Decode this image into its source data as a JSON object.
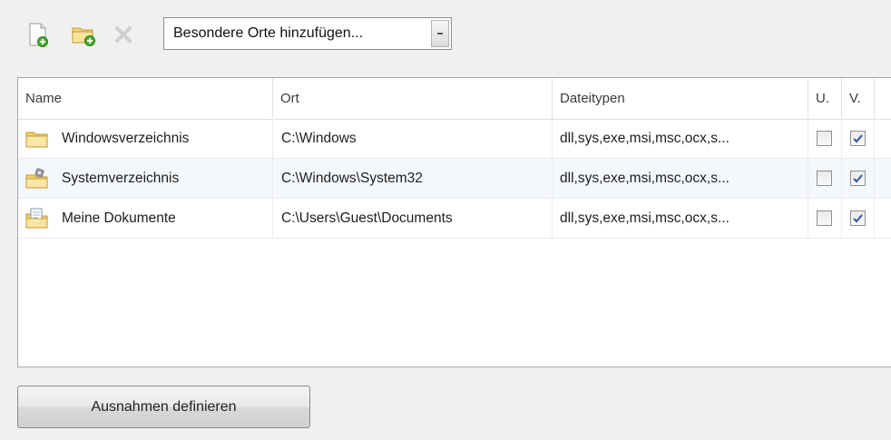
{
  "toolbar": {
    "new_icon": "new-document-icon",
    "folder_icon": "add-folder-icon",
    "delete_icon": "delete-icon",
    "combo_value": "Besondere Orte hinzufügen..."
  },
  "table": {
    "columns": [
      "Name",
      "Ort",
      "Dateitypen",
      "U.",
      "V."
    ],
    "rows": [
      {
        "icon": "folder-icon",
        "name": "Windowsverzeichnis",
        "ort": "C:\\Windows",
        "types": "dll,sys,exe,msi,msc,ocx,s...",
        "u": false,
        "v": true
      },
      {
        "icon": "system-folder-icon",
        "name": "Systemverzeichnis",
        "ort": "C:\\Windows\\System32",
        "types": "dll,sys,exe,msi,msc,ocx,s...",
        "u": false,
        "v": true
      },
      {
        "icon": "documents-folder-icon",
        "name": "Meine Dokumente",
        "ort": "C:\\Users\\Guest\\Documents",
        "types": "dll,sys,exe,msi,msc,ocx,s...",
        "u": false,
        "v": true
      }
    ]
  },
  "footer": {
    "define_button": "Ausnahmen definieren"
  }
}
